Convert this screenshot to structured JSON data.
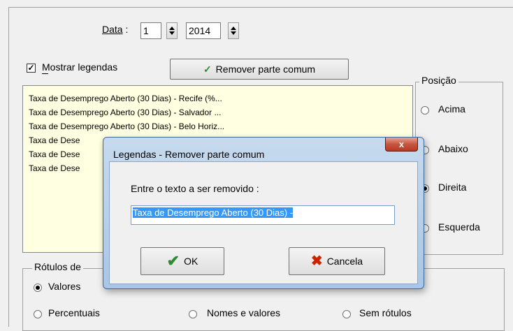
{
  "data_row": {
    "label": "Data",
    "label_suffix": " :",
    "day_value": "1",
    "year_value": "2014"
  },
  "mostrar_legendas": {
    "label": "Mostrar legendas",
    "checked": true
  },
  "remover_button": {
    "label": "Remover parte comum",
    "icon": "check-icon",
    "icon_color": "#2e8b2e"
  },
  "legend_list": [
    "Taxa de Desemprego Aberto (30 Dias) - Recife (%...",
    "Taxa de Desemprego Aberto (30 Dias) - Salvador ...",
    "Taxa de Desemprego Aberto (30 Dias) - Belo Horiz...",
    "Taxa de Dese",
    "Taxa de Dese",
    "Taxa de Dese"
  ],
  "posicao": {
    "title": "Posição",
    "options": [
      "Acima",
      "Abaixo",
      "Direita",
      "Esquerda"
    ],
    "selected": "Direita"
  },
  "rotulos": {
    "title": "Rótulos de",
    "options": [
      "Valores",
      "Percentuais",
      "Nomes e valores",
      "Sem rótulos"
    ],
    "selected": "Valores"
  },
  "dialog": {
    "title": "Legendas - Remover parte comum",
    "close_label": "x",
    "prompt": "Entre o texto a ser removido :",
    "input_value": "Taxa de Desemprego Aberto (30 Dias) -",
    "ok_label": "OK",
    "cancel_label": "Cancela",
    "ok_icon_color": "#2e8b2e",
    "cancel_icon_color": "#cc2200"
  }
}
